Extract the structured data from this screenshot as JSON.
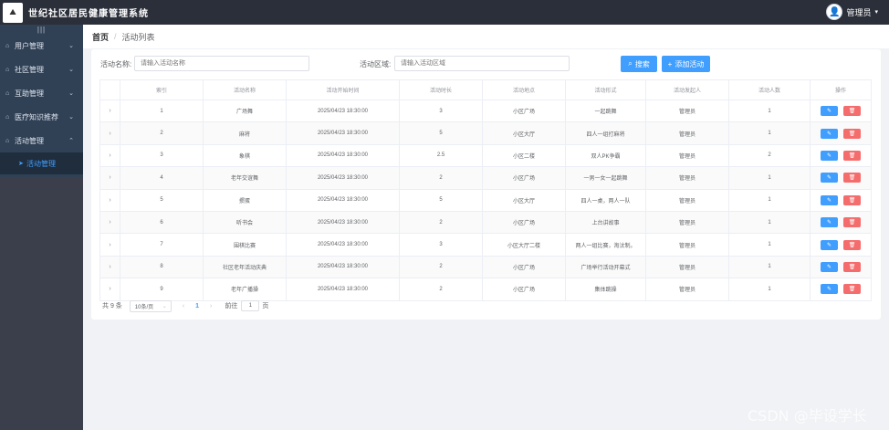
{
  "header": {
    "logo_text": "⛰",
    "app_title": "世纪社区居民健康管理系统",
    "user": {
      "name": "管理员",
      "caret": "▾",
      "avatar_icon": "👤"
    }
  },
  "sidebar": {
    "collapse_icon": "|||",
    "items": [
      {
        "icon": "⌂",
        "label": "用户管理",
        "arrow": "⌄"
      },
      {
        "icon": "⌂",
        "label": "社区管理",
        "arrow": "⌄"
      },
      {
        "icon": "⌂",
        "label": "互助管理",
        "arrow": "⌄"
      },
      {
        "icon": "⌂",
        "label": "医疗知识推荐",
        "arrow": "⌄"
      },
      {
        "icon": "⌂",
        "label": "活动管理",
        "arrow": "⌃"
      }
    ],
    "sub_item": {
      "icon": "➤",
      "label": "活动管理"
    }
  },
  "breadcrumb": {
    "home": "首页",
    "separator": "/",
    "current": "活动列表"
  },
  "filters": {
    "name_label": "活动名称:",
    "name_placeholder": "请输入活动名称",
    "area_label": "活动区域:",
    "area_placeholder": "请输入活动区域",
    "search_label": "搜索",
    "search_icon": "⌕",
    "add_label": "添加活动",
    "add_icon": "+"
  },
  "table": {
    "columns": [
      "",
      "索引",
      "活动名称",
      "活动开始时间",
      "活动时长",
      "活动地点",
      "活动形式",
      "活动发起人",
      "活动人数",
      "操作"
    ],
    "expand_icon": "›",
    "edit_icon": "✎",
    "delete_icon": "🗑",
    "rows": [
      {
        "index": "1",
        "name": "广场舞",
        "start": "2025/04/23 18:30:00",
        "duration": "3",
        "place": "小区广场",
        "form": "一起跳舞",
        "host": "管理员",
        "count": "1"
      },
      {
        "index": "2",
        "name": "麻将",
        "start": "2025/04/23 18:30:00",
        "duration": "5",
        "place": "小区大厅",
        "form": "四人一组打麻将",
        "host": "管理员",
        "count": "1"
      },
      {
        "index": "3",
        "name": "象棋",
        "start": "2025/04/23 18:30:00",
        "duration": "2.5",
        "place": "小区二楼",
        "form": "双人PK争霸",
        "host": "管理员",
        "count": "2"
      },
      {
        "index": "4",
        "name": "老年交谊舞",
        "start": "2025/04/23 18:30:00",
        "duration": "2",
        "place": "小区广场",
        "form": "一男一女一起跳舞",
        "host": "管理员",
        "count": "1"
      },
      {
        "index": "5",
        "name": "掼蛋",
        "start": "2025/04/23 18:30:00",
        "duration": "5",
        "place": "小区大厅",
        "form": "四人一桌，两人一队",
        "host": "管理员",
        "count": "1"
      },
      {
        "index": "6",
        "name": "听书会",
        "start": "2025/04/23 18:30:00",
        "duration": "2",
        "place": "小区广场",
        "form": "上台讲故事",
        "host": "管理员",
        "count": "1"
      },
      {
        "index": "7",
        "name": "围棋比赛",
        "start": "2025/04/23 18:30:00",
        "duration": "3",
        "place": "小区大厅二楼",
        "form": "两人一组比赛，淘汰制。",
        "host": "管理员",
        "count": "1"
      },
      {
        "index": "8",
        "name": "社区老年活动庆典",
        "start": "2025/04/23 18:30:00",
        "duration": "2",
        "place": "小区广场",
        "form": "广场举行活动开幕式",
        "host": "管理员",
        "count": "1"
      },
      {
        "index": "9",
        "name": "老年广播操",
        "start": "2025/04/23 18:30:00",
        "duration": "2",
        "place": "小区广场",
        "form": "集体跳操",
        "host": "管理员",
        "count": "1"
      }
    ]
  },
  "pagination": {
    "total": "共 9 条",
    "page_size": "10条/页",
    "dropdown_icon": "⌄",
    "prev_icon": "‹",
    "current": "1",
    "next_icon": "›",
    "goto_label": "前往",
    "goto_value": "1",
    "goto_suffix": "页"
  },
  "watermark": "CSDN @毕设学长"
}
